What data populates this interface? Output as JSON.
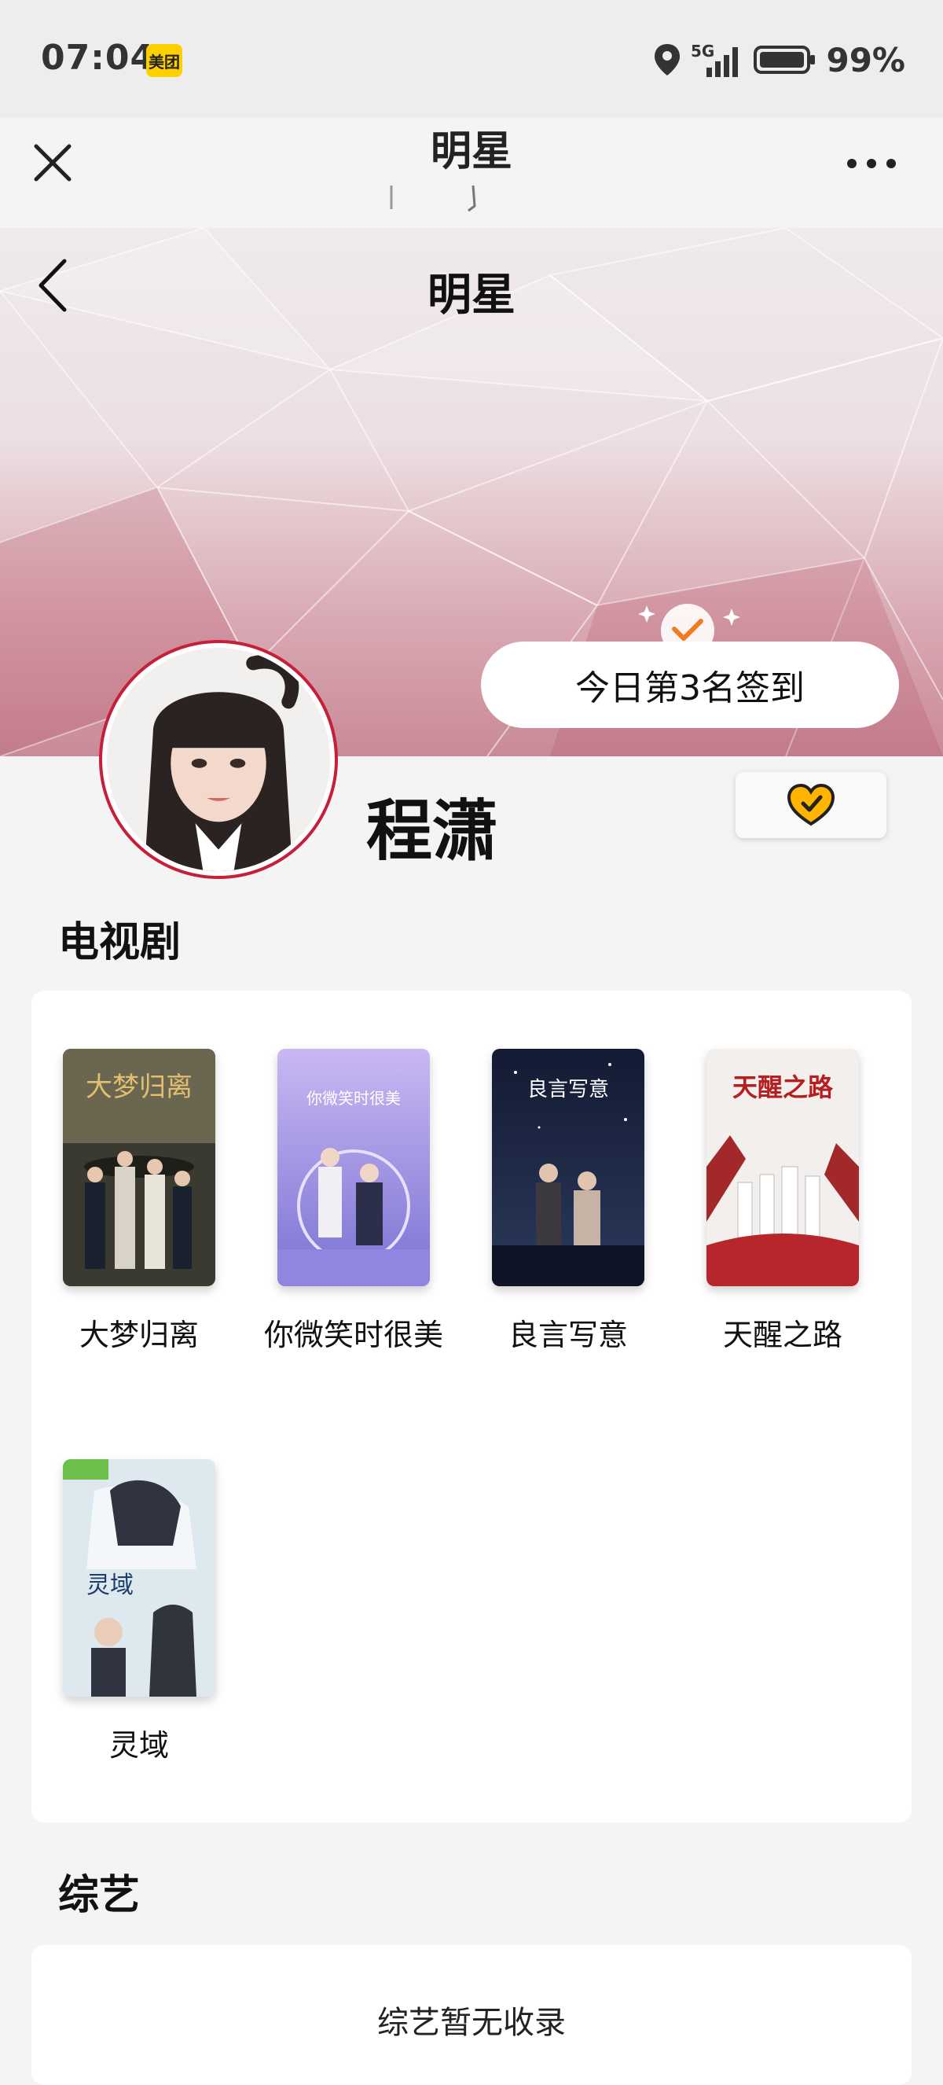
{
  "status_bar": {
    "time": "07:04",
    "app_badge": "美团",
    "network": "5G",
    "battery": "99%"
  },
  "nav": {
    "title": "明星"
  },
  "hero": {
    "title": "明星",
    "checkin_text": "今日第3名签到"
  },
  "profile": {
    "name": "程潇"
  },
  "tv_section": {
    "title": "电视剧",
    "items": [
      {
        "title": "大梦归离",
        "poster_text": "大梦归离"
      },
      {
        "title": "你微笑时很美",
        "poster_text": "你微笑时很美"
      },
      {
        "title": "良言写意",
        "poster_text": "良言写意"
      },
      {
        "title": "天醒之路",
        "poster_text": "天醒之路"
      },
      {
        "title": "灵域",
        "poster_text": "灵域"
      }
    ]
  },
  "variety_section": {
    "title": "综艺",
    "empty_text": "综艺暂无收录"
  },
  "colors": {
    "accent_red": "#c51f3a",
    "checkin_orange": "#f07b1f",
    "heart_yellow": "#ffb400"
  }
}
